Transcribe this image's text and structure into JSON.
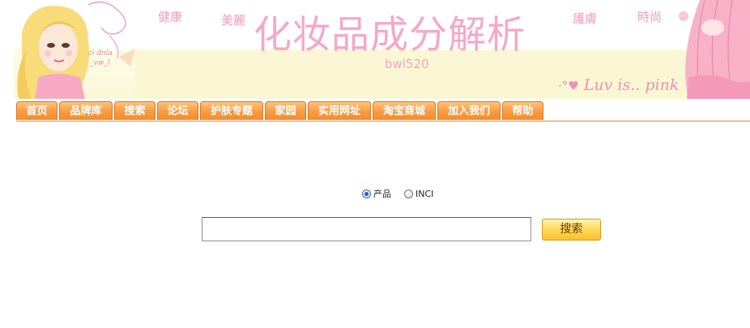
{
  "banner": {
    "title": "化妆品成分解析",
    "subtitle": "bwl520",
    "decor_words": [
      "健康",
      "美麗",
      "護膚",
      "時尚"
    ],
    "slogan_prefix": "Luv is..",
    "slogan_word": "pink"
  },
  "nav": {
    "items": [
      "首页",
      "品牌库",
      "搜索",
      "论坛",
      "护肤专题",
      "家园",
      "实用网址",
      "淘宝商城",
      "加入我们",
      "帮助"
    ]
  },
  "search": {
    "options": [
      {
        "label": "产品",
        "checked": true
      },
      {
        "label": "INCI",
        "checked": false
      }
    ],
    "input_value": "",
    "button_label": "搜索"
  },
  "colors": {
    "nav_orange": "#f99e43",
    "title_pink": "#f5a8c8",
    "button_yellow": "#ffd85a"
  }
}
